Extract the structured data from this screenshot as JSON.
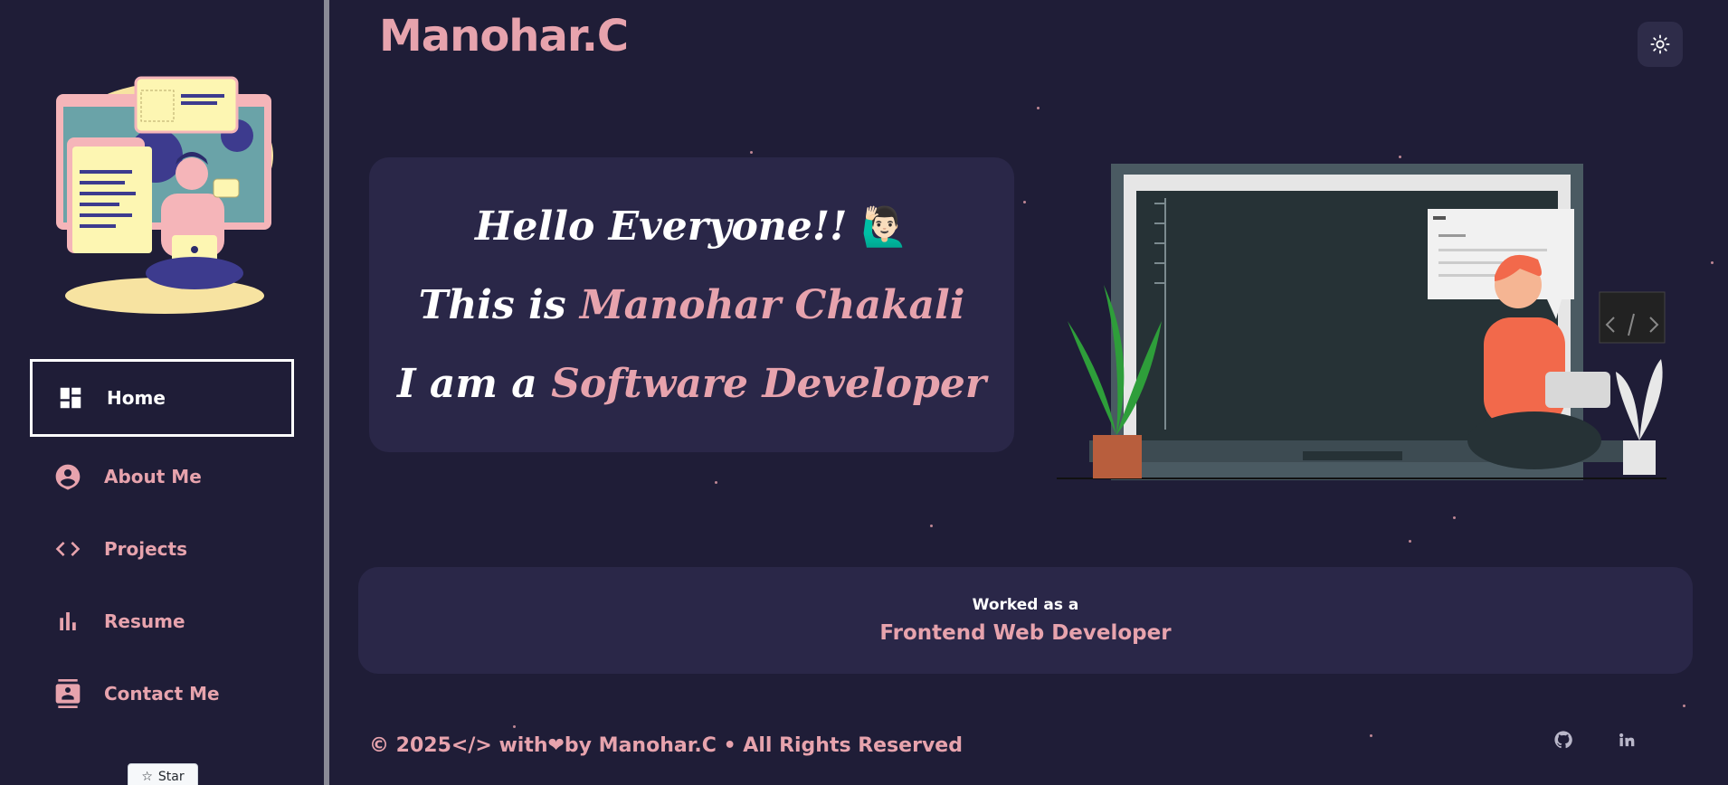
{
  "brand": {
    "name": "Manohar.C"
  },
  "nav": {
    "items": [
      {
        "label": "Home",
        "icon": "dashboard-icon",
        "active": true
      },
      {
        "label": "About Me",
        "icon": "account-circle-icon",
        "active": false
      },
      {
        "label": "Projects",
        "icon": "code-icon",
        "active": false
      },
      {
        "label": "Resume",
        "icon": "bar-chart-icon",
        "active": false
      },
      {
        "label": "Contact Me",
        "icon": "contact-card-icon",
        "active": false
      }
    ]
  },
  "github_star": {
    "label": "Star"
  },
  "intro": {
    "line1": "Hello Everyone!!",
    "line1_emoji": "🙋🏻‍♂️",
    "line2_prefix": "This is ",
    "line2_name": "Manohar Chakali",
    "line3_prefix": "I am a ",
    "line3_role": "Software Developer"
  },
  "work": {
    "pre": "Worked as a",
    "role": "Frontend Web Developer"
  },
  "footer": {
    "text": "© 2025</> with❤by Manohar.C • All Rights Reserved",
    "links": [
      "github-icon",
      "linkedin-icon"
    ]
  },
  "colors": {
    "background": "#1f1d37",
    "card": "#2a2748",
    "accent": "#e7a3ad",
    "text": "#ffffff"
  }
}
